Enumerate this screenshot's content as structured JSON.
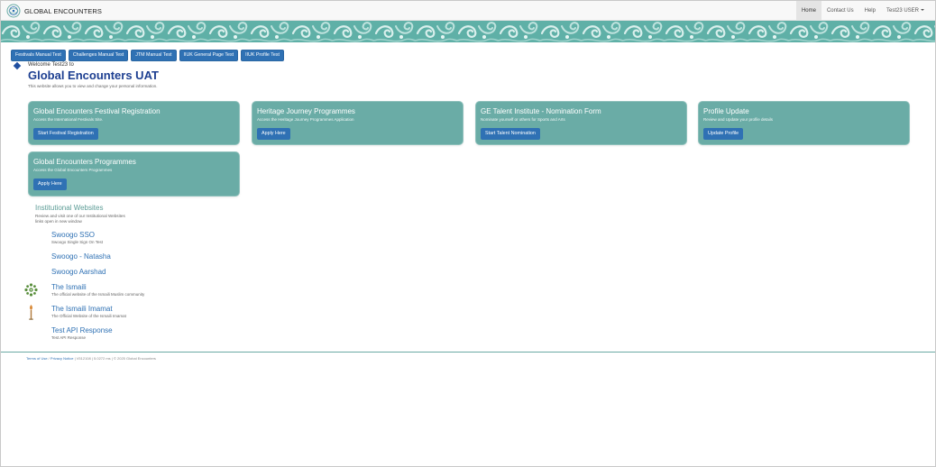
{
  "navbar": {
    "brand": "GLOBAL ENCOUNTERS",
    "items": [
      {
        "label": "Home",
        "active": true
      },
      {
        "label": "Contact Us",
        "active": false
      },
      {
        "label": "Help",
        "active": false
      },
      {
        "label": "Test23 USER",
        "active": false
      }
    ]
  },
  "colors": {
    "banner": "#5fb0a7",
    "card": "#6aaca6",
    "button": "#2f71b4",
    "title": "#1d3f91"
  },
  "test_buttons": [
    {
      "label": "Festivals Manual Test"
    },
    {
      "label": "Challenges Manual Test"
    },
    {
      "label": "JTM Manual Test"
    },
    {
      "label": "IIUK General Page Test"
    },
    {
      "label": "IIUK Profile Test"
    }
  ],
  "welcome": {
    "greeting": "Welcome Test23 to",
    "title": "Global Encounters UAT",
    "subtitle": "This website allows you to view and change your personal information."
  },
  "cards": [
    {
      "title": "Global Encounters Festival Registration",
      "desc": "Access the International Festivals Site.",
      "button": "Start Festival Registration"
    },
    {
      "title": "Heritage Journey Programmes",
      "desc": "Access the Heritage Journey Programmes Application",
      "button": "Apply Here"
    },
    {
      "title": "GE Talent Institute - Nomination Form",
      "desc": "Nominate yourself or others for Sports and Arts",
      "button": "Start Talent Nomination"
    },
    {
      "title": "Profile Update",
      "desc": "Review and Update your profile details",
      "button": "Update Profile"
    },
    {
      "title": "Global Encounters Programmes",
      "desc": "Access the Global Encounters Programmes",
      "button": "Apply Here"
    }
  ],
  "institutional": {
    "title": "Institutional Websites",
    "desc_line1": "Review and visit one of our Institutional Websites",
    "desc_line2": "links open in new window",
    "links": [
      {
        "title": "Swoogo SSO",
        "desc": "Swoogo Single Sign On Test",
        "icon": "none"
      },
      {
        "title": "Swoogo - Natasha",
        "desc": "",
        "icon": "none"
      },
      {
        "title": "Swoogo Aarshad",
        "desc": "",
        "icon": "none"
      },
      {
        "title": "The Ismaili",
        "desc": "The official website of the Ismaili Muslim community",
        "icon": "ismaili-emblem-icon"
      },
      {
        "title": "The Ismaili Imamat",
        "desc": "The Official Website of the Ismaili Imamat",
        "icon": "imamat-torch-icon"
      },
      {
        "title": "Test API Response",
        "desc": "Test API Response",
        "icon": "none"
      }
    ]
  },
  "footer": {
    "terms": "Terms of Use",
    "privacy": "Privacy Notice",
    "rest": " | V512108 | 5.0272 ms | © 2025 Global Encounters"
  }
}
